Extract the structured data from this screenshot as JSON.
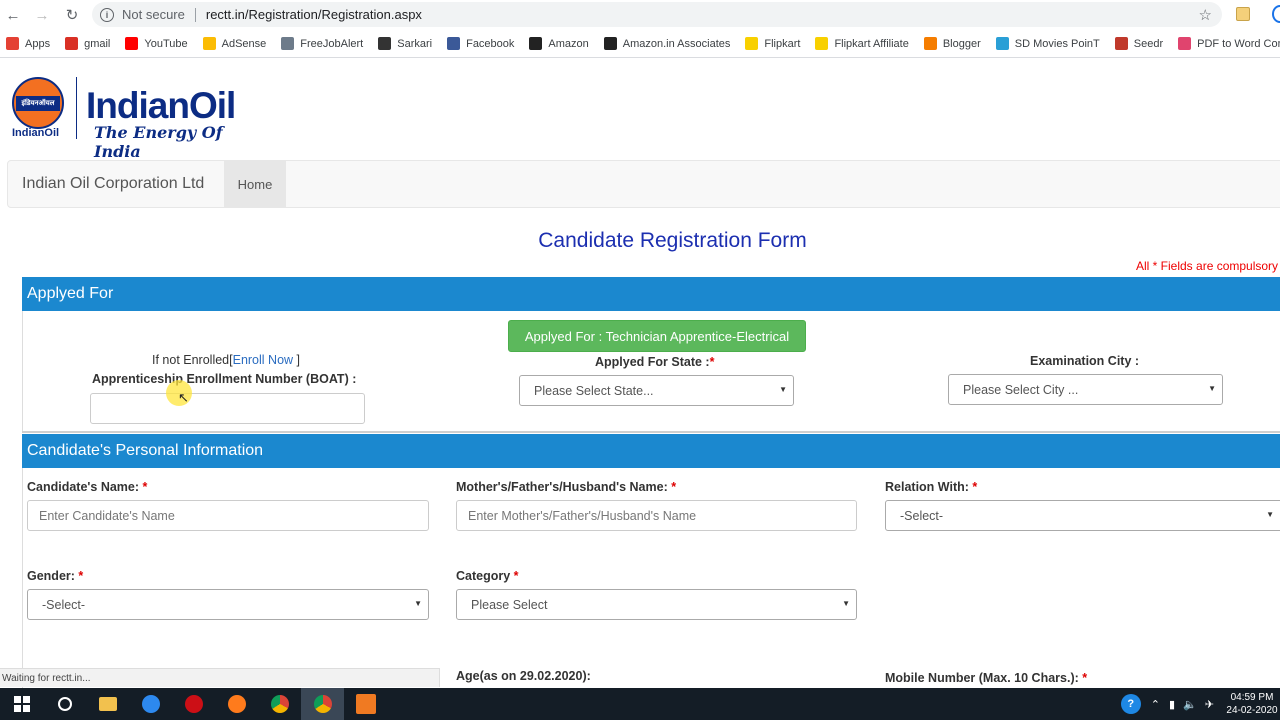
{
  "browser": {
    "insecure_label": "Not secure",
    "url": "rectt.in/Registration/Registration.aspx",
    "status": "Waiting for rectt.in..."
  },
  "bookmarks": [
    {
      "label": "Apps",
      "icon": "apps-grid-icon",
      "color": "#e44134"
    },
    {
      "label": "gmail",
      "icon": "gmail-icon",
      "color": "#d93025"
    },
    {
      "label": "YouTube",
      "icon": "youtube-icon",
      "color": "#ff0000"
    },
    {
      "label": "AdSense",
      "icon": "adsense-icon",
      "color": "#fbbc04"
    },
    {
      "label": "FreeJobAlert",
      "icon": "freejobalert-icon",
      "color": "#6d7b8a"
    },
    {
      "label": "Sarkari",
      "icon": "sarkari-icon",
      "color": "#333333"
    },
    {
      "label": "Facebook",
      "icon": "facebook-icon",
      "color": "#3b5998"
    },
    {
      "label": "Amazon",
      "icon": "amazon-icon",
      "color": "#222222"
    },
    {
      "label": "Amazon.in Associates",
      "icon": "amazon-icon",
      "color": "#222222"
    },
    {
      "label": "Flipkart",
      "icon": "flipkart-icon",
      "color": "#f8d000"
    },
    {
      "label": "Flipkart Affiliate",
      "icon": "flipkart-icon",
      "color": "#f8d000"
    },
    {
      "label": "Blogger",
      "icon": "blogger-icon",
      "color": "#f57d00"
    },
    {
      "label": "SD Movies PoinT",
      "icon": "sd-movies-icon",
      "color": "#2a9fd6"
    },
    {
      "label": "Seedr",
      "icon": "seedr-icon",
      "color": "#c0392b"
    },
    {
      "label": "PDF to Word Converter",
      "icon": "pdf-converter-icon",
      "color": "#e0446e"
    }
  ],
  "logo": {
    "hindi": "इंडियनऑयल",
    "small": "IndianOil",
    "big": "IndianOil",
    "tagline": "The Energy Of India"
  },
  "nav": {
    "brand": "Indian Oil Corporation Ltd",
    "home": "Home"
  },
  "form": {
    "title": "Candidate Registration Form",
    "compulsory_note": "All * Fields are compulsory",
    "applied_section": "Applyed For",
    "applied_button": "Applyed For : Technician Apprentice-Electrical",
    "not_enrolled_prefix": "If not Enrolled[",
    "enroll_link": "Enroll Now",
    "not_enrolled_suffix": " ]",
    "boat_label": "Apprenticeship Enrollment Number (BOAT) :",
    "state_label": "Applyed For State :",
    "state_placeholder": "Please Select State...",
    "city_label": "Examination City :",
    "city_placeholder": "Please Select City ...",
    "personal_section": "Candidate's Personal Information",
    "name_label": "Candidate's Name:",
    "name_placeholder": "Enter Candidate's Name",
    "parent_label": "Mother's/Father's/Husband's Name:",
    "parent_placeholder": "Enter Mother's/Father's/Husband's Name",
    "relation_label": "Relation With:",
    "relation_value": "-Select-",
    "gender_label": "Gender:",
    "gender_value": "-Select-",
    "category_label": "Category",
    "category_value": "Please Select",
    "age_label": "Age(as on 29.02.2020):",
    "mobile_label": "Mobile Number (Max. 10 Chars.):",
    "required_mark": "*"
  },
  "taskbar": {
    "time": "04:59 PM",
    "date": "24-02-2020"
  }
}
